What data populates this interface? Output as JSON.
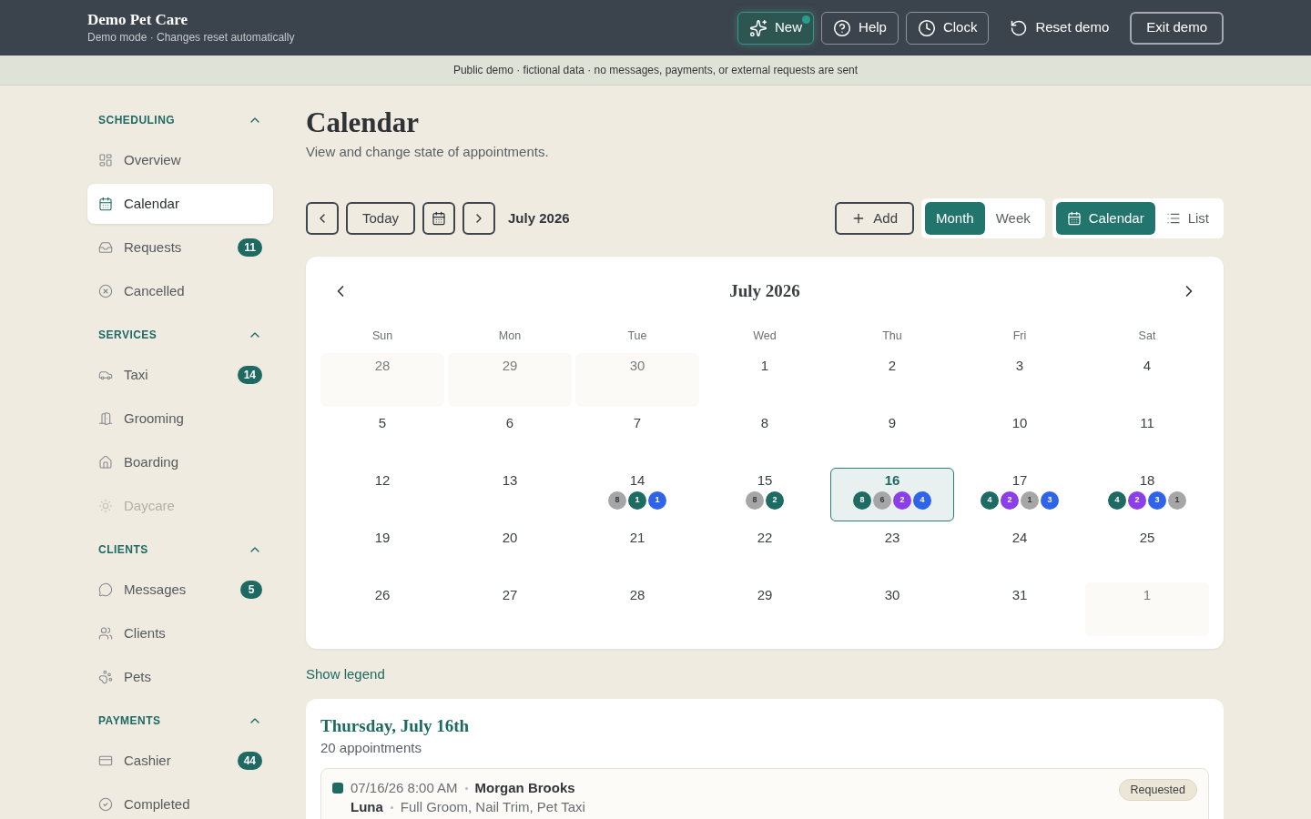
{
  "header": {
    "title": "Demo Pet Care",
    "subtitle": "Demo mode · Changes reset automatically",
    "actions": [
      {
        "kind": "new",
        "label": "New",
        "notification": true
      },
      {
        "kind": "help",
        "label": "Help"
      },
      {
        "kind": "clock",
        "label": "Clock"
      },
      {
        "kind": "reset",
        "label": "Reset demo"
      },
      {
        "kind": "exit",
        "label": "Exit demo"
      }
    ]
  },
  "banner": "Public demo · fictional data · no messages, payments, or external requests are sent",
  "sidebar": {
    "sections": [
      {
        "title": "SCHEDULING",
        "expanded": true,
        "items": [
          {
            "label": "Overview",
            "selected": false,
            "disabled": false
          },
          {
            "label": "Calendar",
            "selected": true,
            "disabled": false
          },
          {
            "label": "Requests",
            "selected": false,
            "disabled": false,
            "badge": "11"
          },
          {
            "label": "Cancelled",
            "selected": false,
            "disabled": false
          }
        ]
      },
      {
        "title": "SERVICES",
        "expanded": true,
        "items": [
          {
            "label": "Taxi",
            "selected": false,
            "disabled": false,
            "badge": "14"
          },
          {
            "label": "Grooming",
            "selected": false,
            "disabled": false
          },
          {
            "label": "Boarding",
            "selected": false,
            "disabled": false
          },
          {
            "label": "Daycare",
            "selected": false,
            "disabled": true
          }
        ]
      },
      {
        "title": "CLIENTS",
        "expanded": true,
        "items": [
          {
            "label": "Messages",
            "selected": false,
            "disabled": false,
            "badge": "5"
          },
          {
            "label": "Clients",
            "selected": false,
            "disabled": false
          },
          {
            "label": "Pets",
            "selected": false,
            "disabled": false
          }
        ]
      },
      {
        "title": "PAYMENTS",
        "expanded": true,
        "items": [
          {
            "label": "Cashier",
            "selected": false,
            "disabled": false,
            "badge": "44"
          },
          {
            "label": "Completed",
            "selected": false,
            "disabled": false
          }
        ]
      }
    ]
  },
  "page": {
    "title": "Calendar",
    "subtitle": "View and change state of appointments."
  },
  "toolbar": {
    "today": "Today",
    "period": "July 2026",
    "add": "Add",
    "views": [
      {
        "label": "Month",
        "selected": true
      },
      {
        "label": "Week",
        "selected": false
      }
    ],
    "layouts": [
      {
        "label": "Calendar",
        "selected": true
      },
      {
        "label": "List",
        "selected": false
      }
    ]
  },
  "calendar": {
    "title": "July 2026",
    "weekdays": [
      "Sun",
      "Mon",
      "Tue",
      "Wed",
      "Thu",
      "Fri",
      "Sat"
    ],
    "days": [
      {
        "label": "28",
        "outside": true,
        "selected": false
      },
      {
        "label": "29",
        "outside": true,
        "selected": false
      },
      {
        "label": "30",
        "outside": true,
        "selected": false
      },
      {
        "label": "1",
        "outside": false,
        "selected": false
      },
      {
        "label": "2",
        "outside": false,
        "selected": false
      },
      {
        "label": "3",
        "outside": false,
        "selected": false
      },
      {
        "label": "4",
        "outside": false,
        "selected": false
      },
      {
        "label": "5",
        "outside": false,
        "selected": false
      },
      {
        "label": "6",
        "outside": false,
        "selected": false
      },
      {
        "label": "7",
        "outside": false,
        "selected": false
      },
      {
        "label": "8",
        "outside": false,
        "selected": false
      },
      {
        "label": "9",
        "outside": false,
        "selected": false
      },
      {
        "label": "10",
        "outside": false,
        "selected": false
      },
      {
        "label": "11",
        "outside": false,
        "selected": false
      },
      {
        "label": "12",
        "outside": false,
        "selected": false
      },
      {
        "label": "13",
        "outside": false,
        "selected": false
      },
      {
        "label": "14",
        "outside": false,
        "selected": false,
        "appointments": [
          {
            "count": "8",
            "color": "#a6a6a6"
          },
          {
            "count": "1",
            "color": "#1d6b63"
          },
          {
            "count": "1",
            "color": "#2f63e9"
          }
        ]
      },
      {
        "label": "15",
        "outside": false,
        "selected": false,
        "appointments": [
          {
            "count": "8",
            "color": "#a6a6a6"
          },
          {
            "count": "2",
            "color": "#1d6b63"
          }
        ]
      },
      {
        "label": "16",
        "outside": false,
        "selected": true,
        "appointments": [
          {
            "count": "8",
            "color": "#1d6b63"
          },
          {
            "count": "6",
            "color": "#a6a6a6"
          },
          {
            "count": "2",
            "color": "#8b3fe8"
          },
          {
            "count": "4",
            "color": "#2f63e9"
          }
        ]
      },
      {
        "label": "17",
        "outside": false,
        "selected": false,
        "appointments": [
          {
            "count": "4",
            "color": "#1d6b63"
          },
          {
            "count": "2",
            "color": "#8b3fe8"
          },
          {
            "count": "1",
            "color": "#a6a6a6"
          },
          {
            "count": "3",
            "color": "#2f63e9"
          }
        ]
      },
      {
        "label": "18",
        "outside": false,
        "selected": false,
        "appointments": [
          {
            "count": "4",
            "color": "#1d6b63"
          },
          {
            "count": "2",
            "color": "#8b3fe8"
          },
          {
            "count": "3",
            "color": "#2f63e9"
          },
          {
            "count": "1",
            "color": "#a6a6a6"
          }
        ]
      },
      {
        "label": "19",
        "outside": false,
        "selected": false
      },
      {
        "label": "20",
        "outside": false,
        "selected": false
      },
      {
        "label": "21",
        "outside": false,
        "selected": false
      },
      {
        "label": "22",
        "outside": false,
        "selected": false
      },
      {
        "label": "23",
        "outside": false,
        "selected": false
      },
      {
        "label": "24",
        "outside": false,
        "selected": false
      },
      {
        "label": "25",
        "outside": false,
        "selected": false
      },
      {
        "label": "26",
        "outside": false,
        "selected": false
      },
      {
        "label": "27",
        "outside": false,
        "selected": false
      },
      {
        "label": "28",
        "outside": false,
        "selected": false
      },
      {
        "label": "29",
        "outside": false,
        "selected": false
      },
      {
        "label": "30",
        "outside": false,
        "selected": false
      },
      {
        "label": "31",
        "outside": false,
        "selected": false
      },
      {
        "label": "1",
        "outside": true,
        "selected": false
      }
    ]
  },
  "legend_link": "Show legend",
  "day_detail": {
    "title": "Thursday, July 16th",
    "count": "20 appointments",
    "appointments": [
      {
        "color": "#1d6b63",
        "time": "07/16/26 8:00 AM",
        "client": "Morgan Brooks",
        "pet": "Luna",
        "services": "Full Groom, Nail Trim, Pet Taxi",
        "status": "Requested"
      }
    ]
  }
}
